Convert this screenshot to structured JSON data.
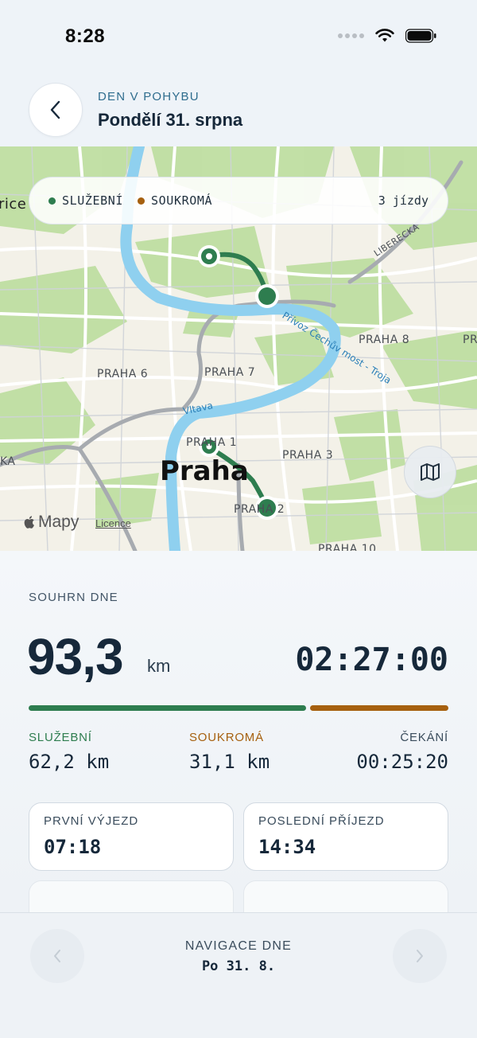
{
  "status_bar": {
    "time": "8:28"
  },
  "header": {
    "eyebrow": "DEN V POHYBU",
    "title": "Pondělí 31. srpna"
  },
  "map": {
    "legend": {
      "business": {
        "label": "SLUŽEBNÍ",
        "color": "#2e7d4f"
      },
      "private": {
        "label": "SOUKROMÁ",
        "color": "#a6600f"
      },
      "trip_count": "3 jízdy"
    },
    "city_label": "Praha",
    "district_labels": {
      "praha6": "PRAHA 6",
      "praha7": "PRAHA 7",
      "praha8": "PRAHA 8",
      "praha3": "PRAHA 3",
      "praha10": "PRAHA 10",
      "praha1": "PRAHA 1",
      "praha2": "PRAHA 2",
      "left_edge": "rice",
      "left_edge2": "KA",
      "right_edge": "PR"
    },
    "road_label": "LIBERECKÁ",
    "river_labels": {
      "vltava": "Vltava",
      "ferry": "Přívoz Čechův most - Troja"
    },
    "attribution": "Mapy",
    "licence": "Licence",
    "route_color": "#2e7d4f"
  },
  "summary": {
    "section_label": "SOUHRN DNE",
    "distance": "93,3",
    "distance_unit": "km",
    "duration": "02:27:00",
    "business_share": 0.667,
    "stats": {
      "business": {
        "label": "SLUŽEBNÍ",
        "value": "62,2 km",
        "color": "#2e7d4f"
      },
      "private": {
        "label": "SOUKROMÁ",
        "value": "31,1 km",
        "color": "#a6600f"
      },
      "waiting": {
        "label": "ČEKÁNÍ",
        "value": "00:25:20",
        "color": "#3a4c5c"
      }
    },
    "cards": {
      "first_departure": {
        "label": "PRVNÍ VÝJEZD",
        "value": "07:18"
      },
      "last_arrival": {
        "label": "POSLEDNÍ PŘÍJEZD",
        "value": "14:34"
      }
    }
  },
  "bottom_nav": {
    "label": "NAVIGACE DNE",
    "date": "Po 31. 8."
  }
}
